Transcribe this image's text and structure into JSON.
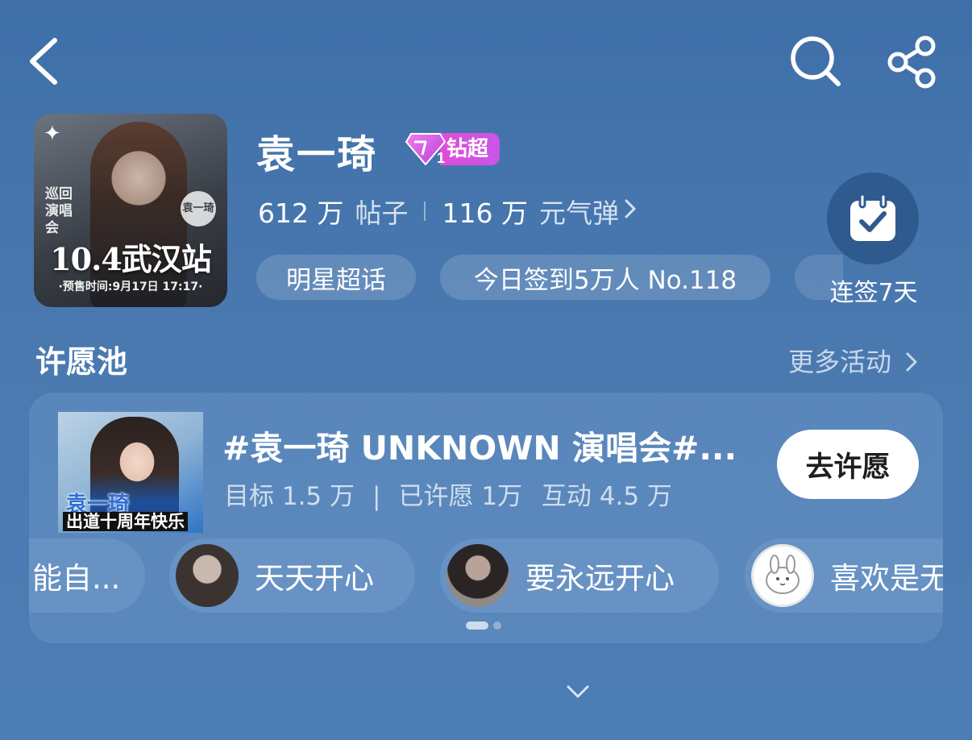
{
  "nav": {
    "back_icon": "chevron-left-icon",
    "search_icon": "search-icon",
    "share_icon": "share-icon"
  },
  "header": {
    "cover": {
      "main_title": "10.4武汉站",
      "sub_title": "·预售时间:9月17日 17:17·",
      "side_text": "巡回演唱会",
      "badge_name": "袁一琦"
    },
    "title": "袁一琦",
    "tier_badge": {
      "level": "1",
      "label": "钻超",
      "color": "#d64fdc"
    },
    "posts_count": "612 万",
    "posts_label": "帖子",
    "energy_count": "116 万",
    "energy_label": "元气弹",
    "chips": [
      "明星超话",
      "今日签到5万人 No.118"
    ],
    "checkin_label": "连签7天"
  },
  "wish_pool": {
    "section_title": "许愿池",
    "more_link": "更多活动",
    "card": {
      "thumb_name": "袁一琦",
      "thumb_caption": "出道十周年快乐",
      "title": "#袁一琦 UNKNOWN 演唱会#...",
      "target": "目标 1.5 万",
      "divider": "|",
      "wished": "已许愿 1万",
      "interactions": "互动 4.5 万",
      "button_label": "去许愿"
    },
    "wishes": [
      "能自...",
      "天天开心",
      "要永远开心",
      "喜欢是无"
    ]
  },
  "colors": {
    "background": "#4676ad",
    "accent_badge": "#d64fdc",
    "checkin_circle": "#2f5a8e"
  }
}
